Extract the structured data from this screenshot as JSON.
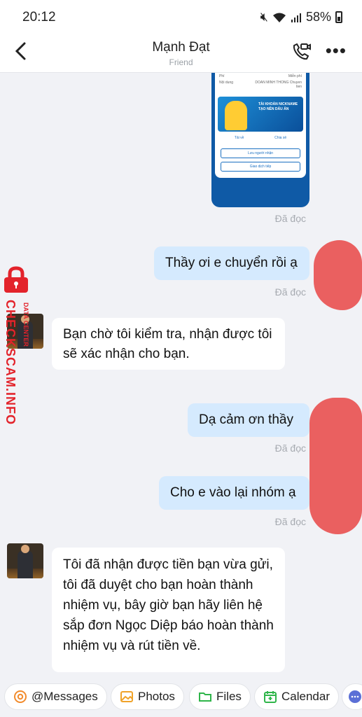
{
  "status_bar": {
    "time": "20:12",
    "battery": "58%"
  },
  "header": {
    "title": "Mạnh Đạt",
    "subtitle": "Friend"
  },
  "receipt": {
    "fee_label": "Phí",
    "fee_value": "Miễn phí",
    "content_label": "Nội dung",
    "content_value": "DOAN MINH THONG Chuyen tien",
    "banner_text": "TÀI KHOẢN NICKNAME TẠO NÊN DẤU ẤN",
    "save_label": "Tải về",
    "share_label": "Chia sẻ",
    "save_recipient": "Lưu người nhận",
    "next_transaction": "Giao dịch tiếp"
  },
  "messages": [
    {
      "dir": "out",
      "text": "Thầy ơi e chuyển rồi ạ"
    },
    {
      "dir": "in",
      "text": "Bạn chờ tôi kiểm tra, nhận được tôi sẽ xác nhận cho bạn."
    },
    {
      "dir": "out",
      "text": "Dạ cảm ơn thầy"
    },
    {
      "dir": "out",
      "text": "Cho e vào lại nhóm ạ"
    },
    {
      "dir": "in",
      "text": "Tôi đã nhận được tiền bạn vừa gửi, tôi đã duyệt cho bạn hoàn thành nhiệm vụ, bây giờ bạn hãy liên hệ sắp đơn Ngọc Diệp báo hoàn thành nhiệm vụ và rút tiền về."
    }
  ],
  "read_label": "Đã đọc",
  "watermark": {
    "brand": "CHECKSCAM.INFO",
    "sub": "DATA CENTER"
  },
  "quick_actions": [
    {
      "label": "@Messages",
      "icon": "at-icon"
    },
    {
      "label": "Photos",
      "icon": "photo-icon"
    },
    {
      "label": "Files",
      "icon": "folder-icon"
    },
    {
      "label": "Calendar",
      "icon": "calendar-icon"
    }
  ],
  "colors": {
    "outgoing_bubble": "#d5eafe",
    "incoming_bubble": "#ffffff",
    "background": "#f1f2f6",
    "accent": "#0f5aa6",
    "watermark": "#e3232b"
  }
}
